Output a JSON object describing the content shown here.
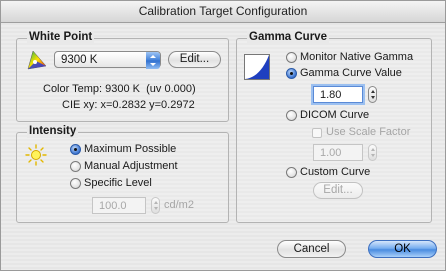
{
  "window": {
    "title": "Calibration Target Configuration"
  },
  "white_point": {
    "title": "White Point",
    "icon": "color-gamut-icon",
    "selected_value": "9300 K",
    "edit_label": "Edit...",
    "color_temp": "Color Temp: 9300 K  (uv 0.000)",
    "cie_xy": "CIE xy: x=0.2832 y=0.2972"
  },
  "intensity": {
    "title": "Intensity",
    "icon": "sun-icon",
    "options": [
      {
        "label": "Maximum Possible",
        "selected": true
      },
      {
        "label": "Manual Adjustment",
        "selected": false
      },
      {
        "label": "Specific Level",
        "selected": false
      }
    ],
    "level_value": "100.0",
    "level_unit": "cd/m2"
  },
  "gamma_curve": {
    "title": "Gamma Curve",
    "icon": "gamma-curve-icon",
    "options": {
      "monitor_native": {
        "label": "Monitor Native Gamma",
        "selected": false
      },
      "gamma_value": {
        "label": "Gamma Curve Value",
        "selected": true
      },
      "dicom": {
        "label": "DICOM Curve",
        "selected": false
      },
      "custom": {
        "label": "Custom Curve",
        "selected": false
      }
    },
    "gamma_value_field": "1.80",
    "use_scale_factor_label": "Use Scale Factor",
    "scale_factor_value": "1.00",
    "custom_edit_label": "Edit..."
  },
  "buttons": {
    "cancel_label": "Cancel",
    "ok_label": "OK"
  },
  "colors": {
    "accent": "#3b74d1",
    "ok_button": "#5a9ae6",
    "curve_fill": "#1f3fbf"
  }
}
